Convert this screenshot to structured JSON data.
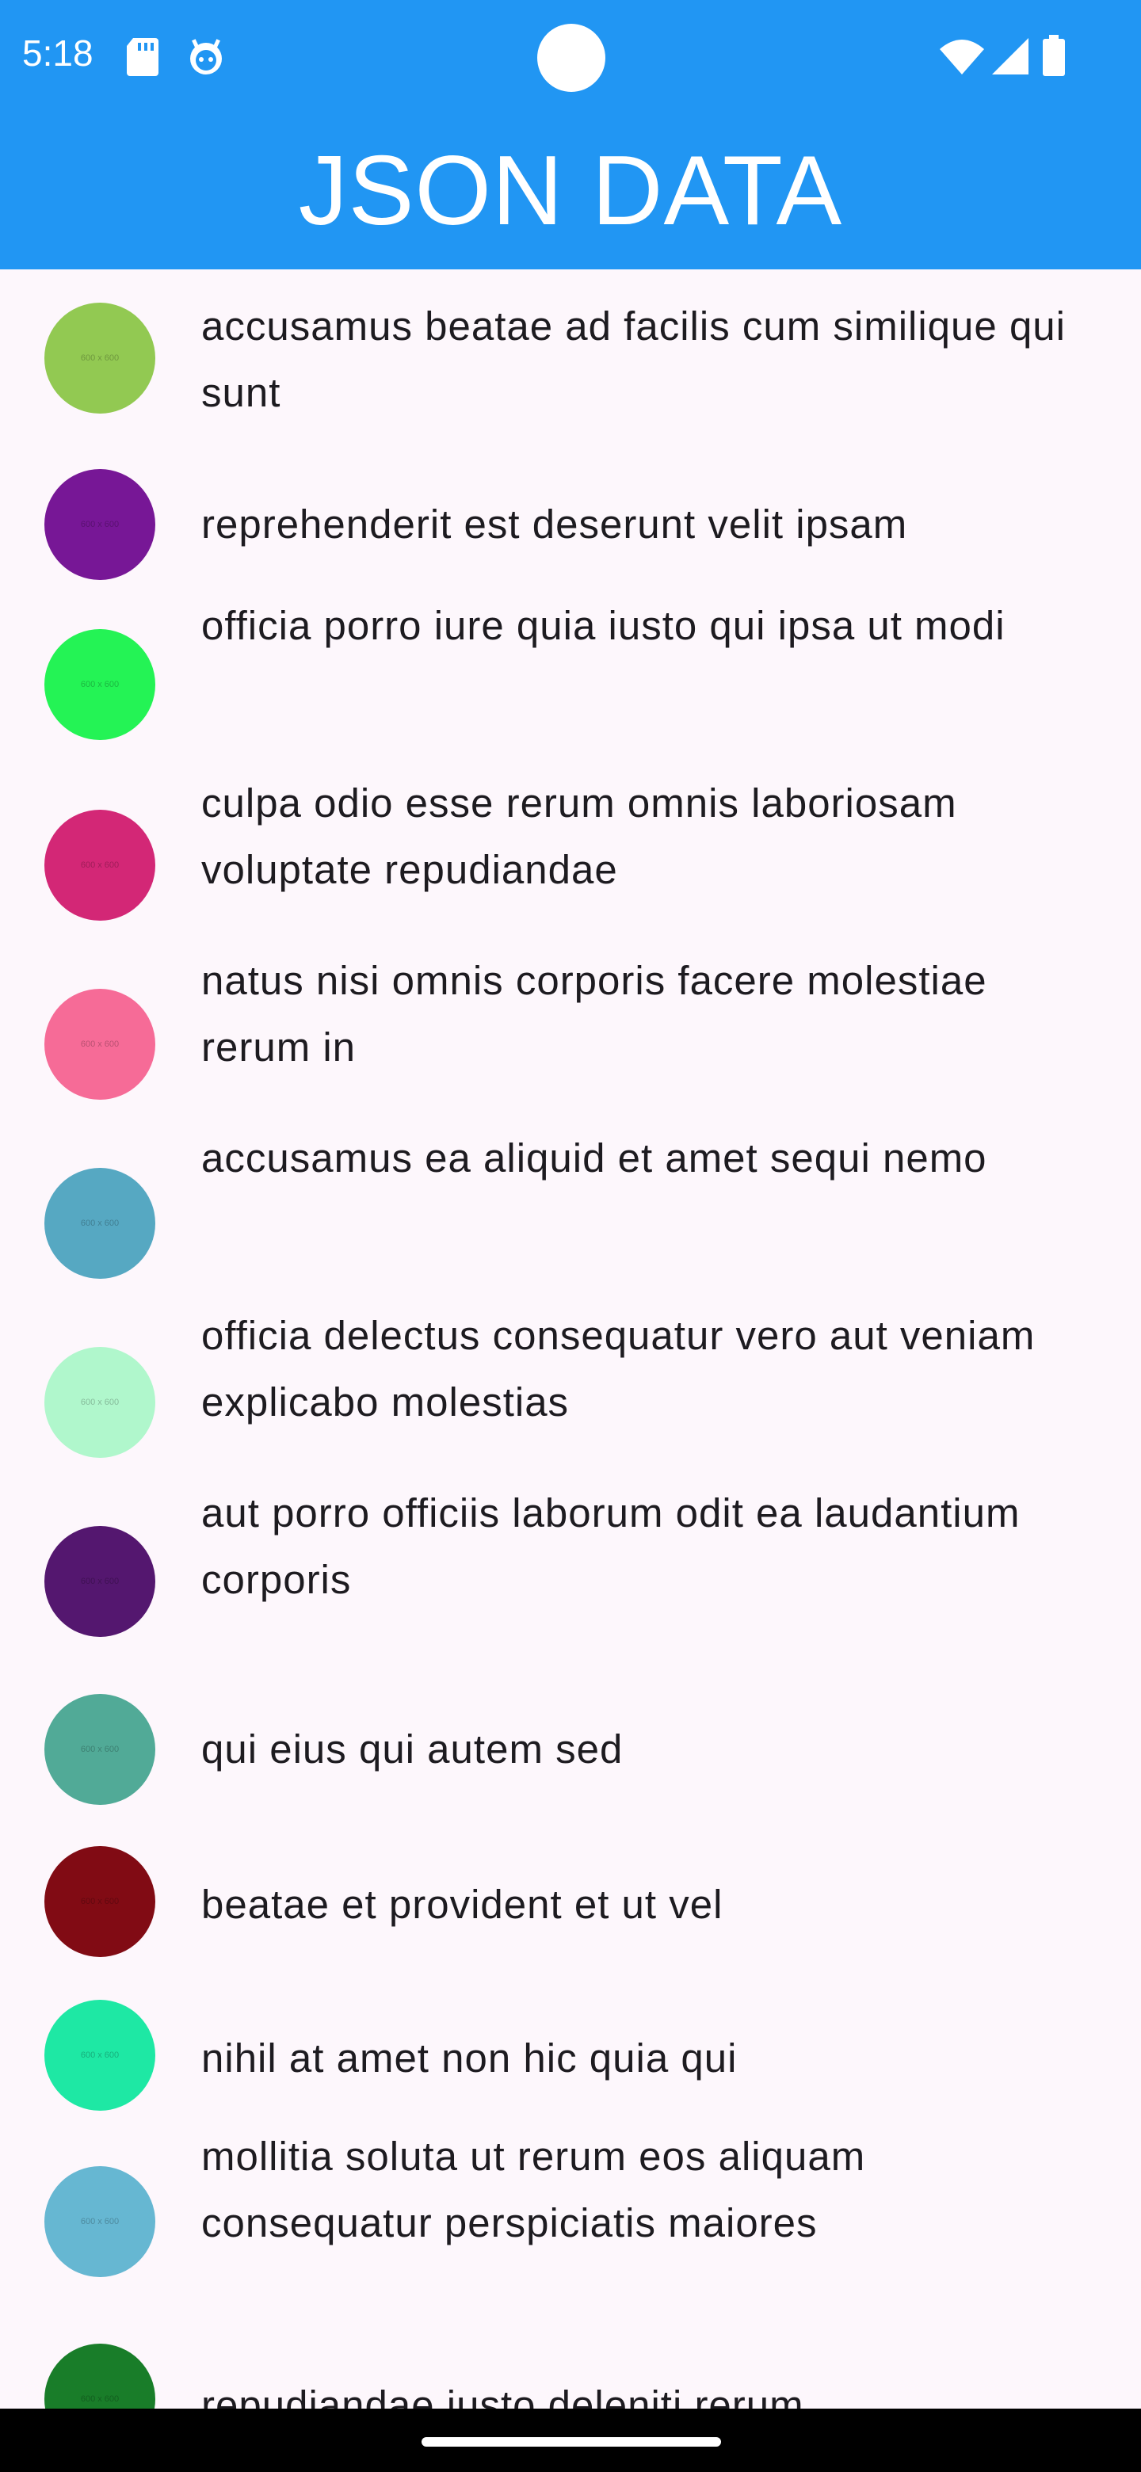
{
  "status_bar": {
    "time": "5:18",
    "icons": [
      "sd-card-icon",
      "android-icon",
      "wifi-icon",
      "signal-icon",
      "battery-icon"
    ]
  },
  "app_bar": {
    "title": "JSON DATA",
    "color": "#2196f3"
  },
  "items": [
    {
      "title": "accusamus beatae ad facilis cum similique qui sunt",
      "color": "#92c952",
      "thumb_label": "600 x 600"
    },
    {
      "title": "reprehenderit est deserunt velit ipsam",
      "color": "#771796",
      "thumb_label": "600 x 600"
    },
    {
      "title": "officia porro iure quia iusto qui ipsa ut modi",
      "color": "#24f355",
      "thumb_label": "600 x 600"
    },
    {
      "title": "culpa odio esse rerum omnis laboriosam voluptate repudiandae",
      "color": "#d32776",
      "thumb_label": "600 x 600"
    },
    {
      "title": "natus nisi omnis corporis facere molestiae rerum in",
      "color": "#f66b97",
      "thumb_label": "600 x 600"
    },
    {
      "title": "accusamus ea aliquid et amet sequi nemo",
      "color": "#56a8c2",
      "thumb_label": "600 x 600"
    },
    {
      "title": "officia delectus consequatur vero aut veniam explicabo molestias",
      "color": "#b0f7cc",
      "thumb_label": "600 x 600"
    },
    {
      "title": "aut porro officiis laborum odit ea laudantium corporis",
      "color": "#54176f",
      "thumb_label": "600 x 600"
    },
    {
      "title": "qui eius qui autem sed",
      "color": "#51aa97",
      "thumb_label": "600 x 600"
    },
    {
      "title": "beatae et provident et ut vel",
      "color": "#810b14",
      "thumb_label": "600 x 600"
    },
    {
      "title": "nihil at amet non hic quia qui",
      "color": "#1ee8a4",
      "thumb_label": "600 x 600"
    },
    {
      "title": "mollitia soluta ut rerum eos aliquam consequatur perspiciatis maiores",
      "color": "#66b7d2",
      "thumb_label": "600 x 600"
    },
    {
      "title": "repudiandae iusto deleniti rerum",
      "color": "#197d29",
      "thumb_label": "600 x 600"
    }
  ]
}
